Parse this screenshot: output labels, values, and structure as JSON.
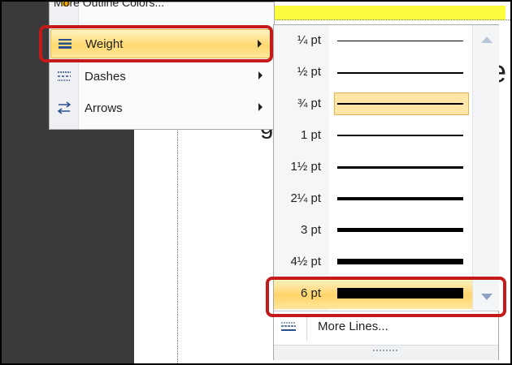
{
  "background": {
    "top_item_label": "More Outline Colors...",
    "letter_e": "e",
    "letter_g": "g"
  },
  "menu": {
    "items": [
      {
        "label": "Weight",
        "mnemonic": "W",
        "highlighted": true,
        "icon": "line-weight-icon"
      },
      {
        "label": "Dashes",
        "mnemonic": "s",
        "highlighted": false,
        "icon": "dashes-icon"
      },
      {
        "label": "Arrows",
        "mnemonic": "r",
        "highlighted": false,
        "icon": "arrows-icon"
      }
    ]
  },
  "weights": {
    "options": [
      {
        "label": "¼ pt",
        "weight_pt": 0.25
      },
      {
        "label": "½ pt",
        "weight_pt": 0.5
      },
      {
        "label": "¾ pt",
        "weight_pt": 0.75,
        "selected": true
      },
      {
        "label": "1 pt",
        "weight_pt": 1
      },
      {
        "label": "1½ pt",
        "weight_pt": 1.5
      },
      {
        "label": "2¼ pt",
        "weight_pt": 2.25
      },
      {
        "label": "3 pt",
        "weight_pt": 3
      },
      {
        "label": "4½ pt",
        "weight_pt": 4.5
      },
      {
        "label": "6 pt",
        "weight_pt": 6,
        "highlighted": true
      }
    ],
    "more_lines_label": "More Lines..."
  },
  "colors": {
    "highlight_border": "#e3b64e",
    "highlight_fill": "#ffd970",
    "annotation_red": "#c41a1a"
  }
}
